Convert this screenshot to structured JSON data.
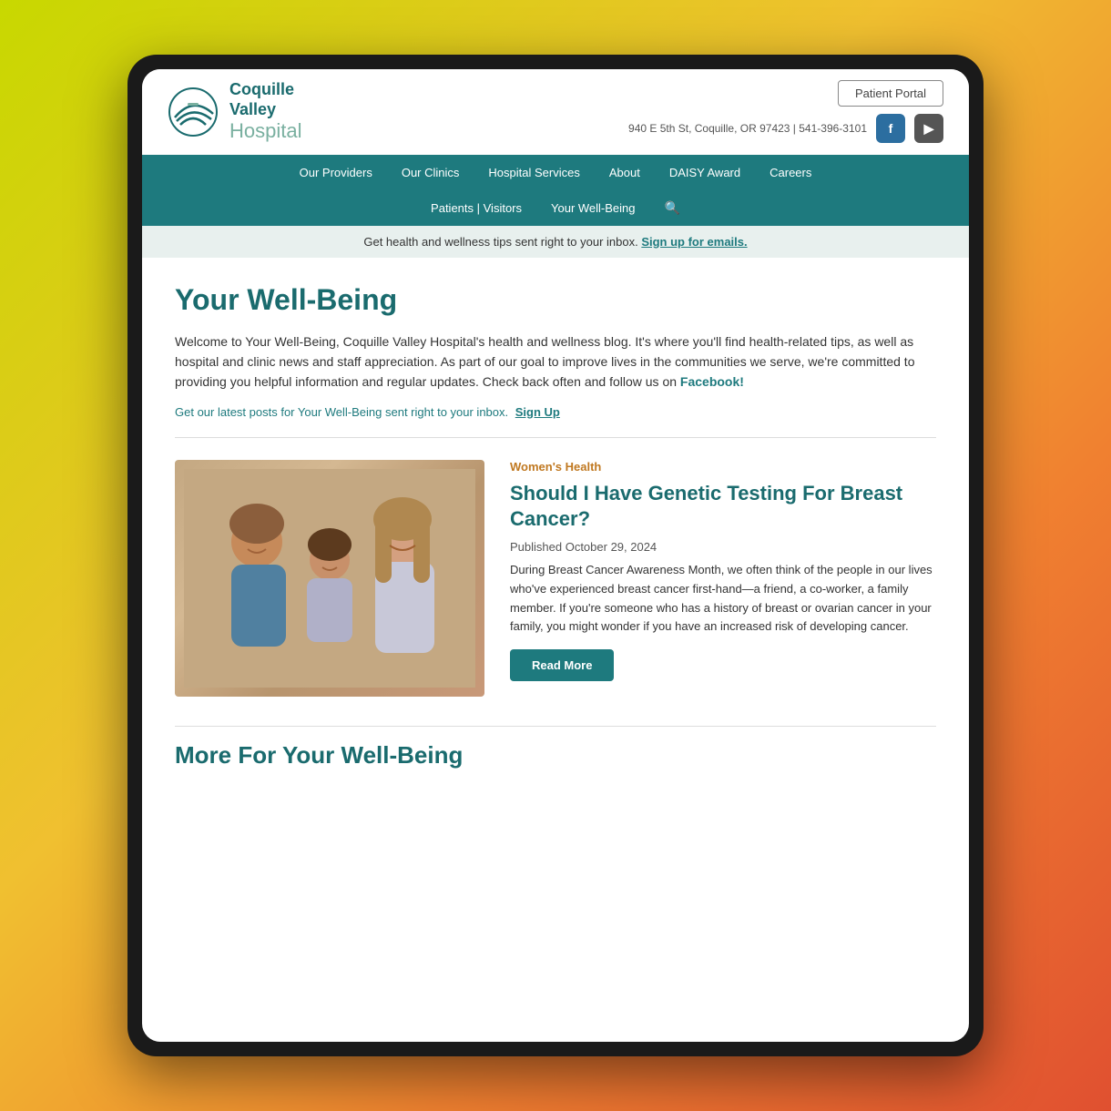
{
  "device": {
    "title": "Coquille Valley Hospital Website"
  },
  "header": {
    "logo": {
      "line1": "Coquille",
      "line2": "Valley",
      "line3": "Hospital"
    },
    "patient_portal_label": "Patient Portal",
    "contact": "940 E 5th St, Coquille, OR 97423 | 541-396-3101",
    "social": {
      "facebook_label": "f",
      "youtube_label": "▶"
    }
  },
  "nav": {
    "row1": [
      {
        "label": "Our Providers"
      },
      {
        "label": "Our Clinics"
      },
      {
        "label": "Hospital Services"
      },
      {
        "label": "About"
      },
      {
        "label": "DAISY Award"
      },
      {
        "label": "Careers"
      }
    ],
    "row2": [
      {
        "label": "Patients | Visitors"
      },
      {
        "label": "Your Well-Being"
      }
    ],
    "search_icon": "🔍"
  },
  "banner": {
    "text": "Get health and wellness tips sent right to your inbox.",
    "link_label": "Sign up for emails."
  },
  "main": {
    "page_title": "Your Well-Being",
    "intro_paragraph": "Welcome to Your Well-Being, Coquille Valley Hospital's health and wellness blog. It's where you'll find health-related tips, as well as hospital and clinic news and staff appreciation. As part of our goal to improve lives in the communities we serve, we're committed to providing you helpful information and regular updates. Check back often and follow us on",
    "facebook_link": "Facebook!",
    "signup_prefix": "Get our latest posts for Your Well-Being sent right to your inbox.",
    "signup_link": "Sign Up",
    "article": {
      "category": "Women's Health",
      "title": "Should I Have Genetic Testing For Breast Cancer?",
      "published": "Published October 29, 2024",
      "excerpt": "During Breast Cancer Awareness Month, we often think of the people in our lives who've experienced breast cancer first-hand—a friend, a co-worker, a family member. If you're someone who has a history of breast or ovarian cancer in your family, you might wonder if you have an increased risk of developing cancer.",
      "read_more_label": "Read More"
    },
    "more_section_title": "More For Your Well-Being"
  }
}
